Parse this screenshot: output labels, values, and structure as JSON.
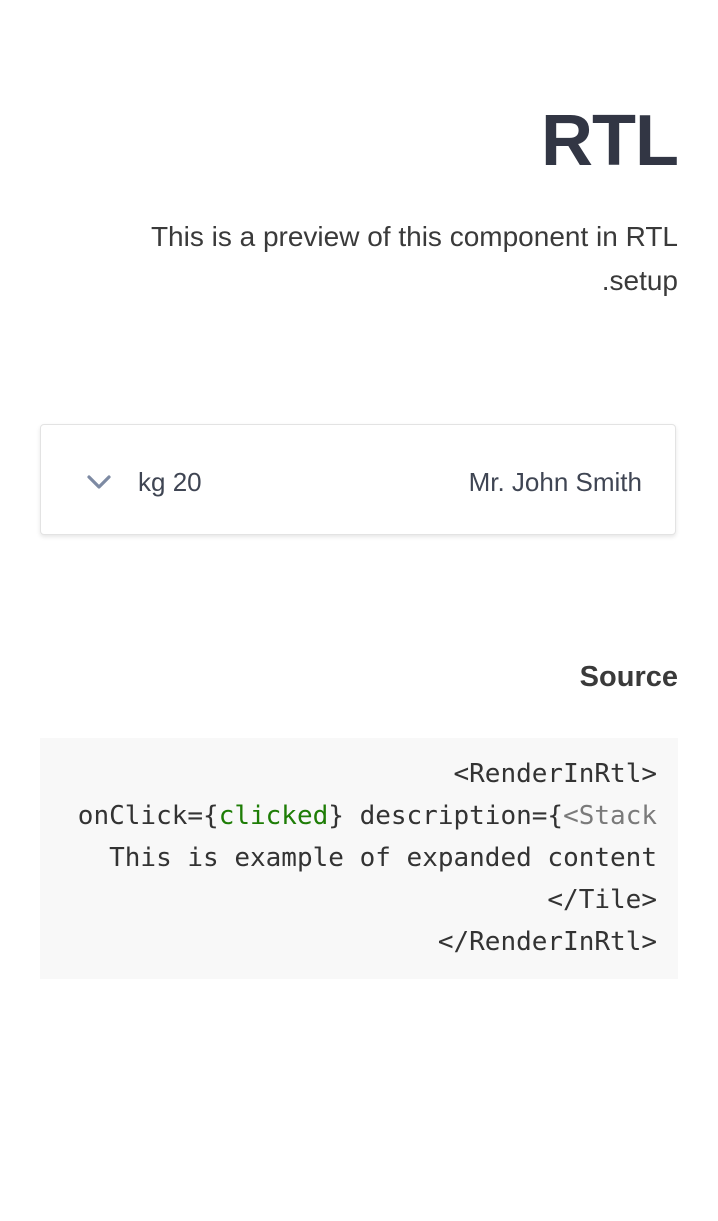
{
  "header": {
    "title": "RTL",
    "description": "This is a preview of this component in RTL setup."
  },
  "tile": {
    "name": "Mr. John Smith",
    "description": "20 kg",
    "expand_icon": "chevron-down-icon"
  },
  "source": {
    "heading": "Source",
    "lines": {
      "line1": "<RenderInRtl>",
      "line2_a": "<Stack",
      "line2_b": "clicked",
      "line2_onclick": "onClick={",
      "line2_close": "} description={",
      "line3": "This is example of expanded content",
      "line4": "<Tile/>",
      "line5": "<RenderInRtl/>"
    }
  },
  "colors": {
    "title": "#323644",
    "code_background": "#f8f8f8",
    "code_keyword": "#1e7d06",
    "chevron": "#7d8aa3"
  }
}
